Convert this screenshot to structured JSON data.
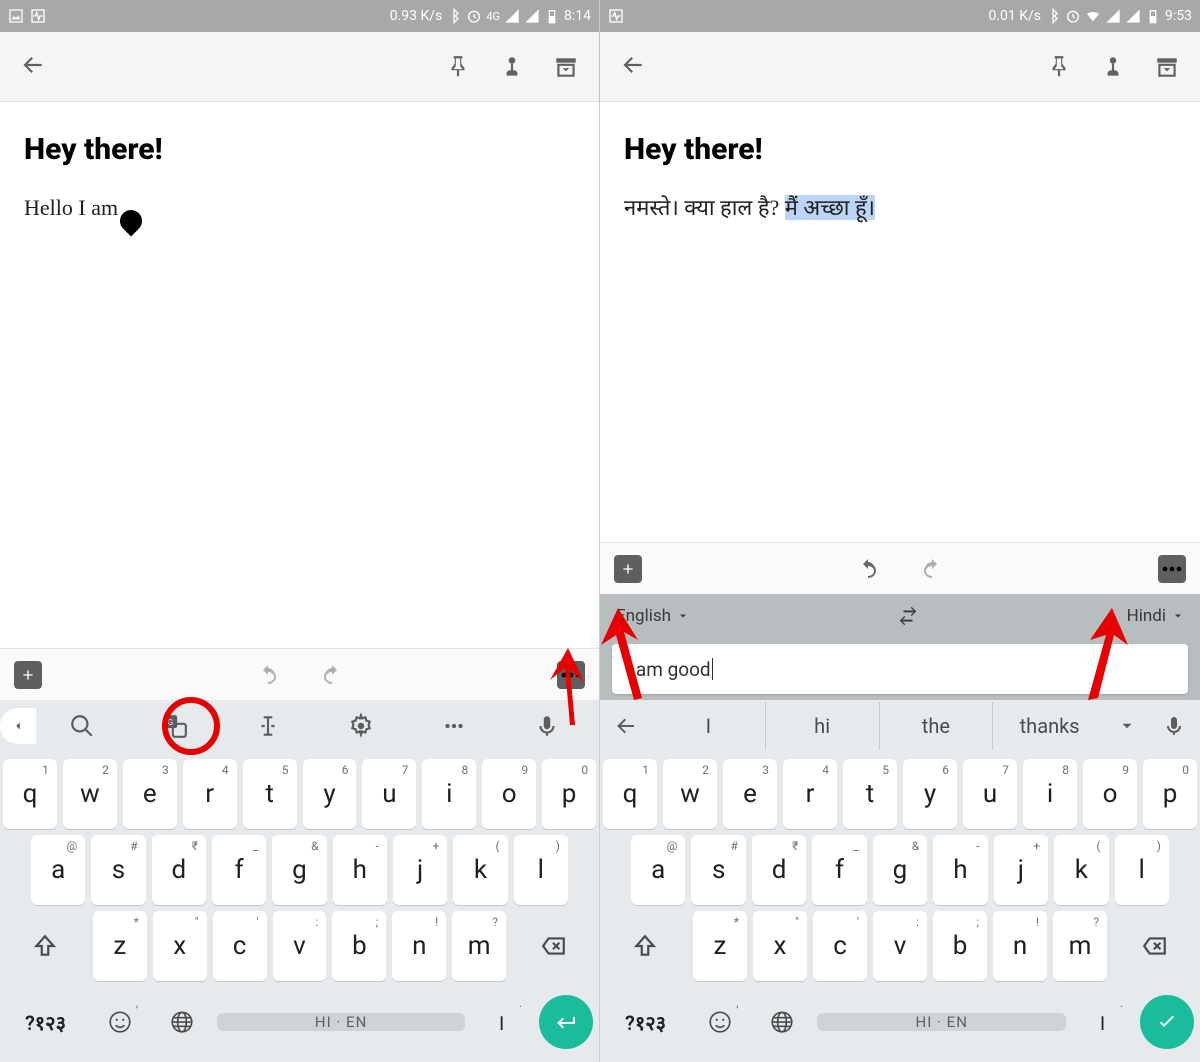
{
  "left": {
    "status": {
      "speed": "0.93 K/s",
      "net": "4G",
      "time": "8:14"
    },
    "heading": "Hey there!",
    "body": "Hello I am",
    "toolstrip": [
      "search",
      "translate",
      "cursor",
      "settings",
      "more",
      "mic"
    ],
    "keyboard": {
      "row1": [
        [
          "q",
          "1"
        ],
        [
          "w",
          "2"
        ],
        [
          "e",
          "3"
        ],
        [
          "r",
          "4"
        ],
        [
          "t",
          "5"
        ],
        [
          "y",
          "6"
        ],
        [
          "u",
          "7"
        ],
        [
          "i",
          "8"
        ],
        [
          "o",
          "9"
        ],
        [
          "p",
          "0"
        ]
      ],
      "row2": [
        [
          "a",
          "@"
        ],
        [
          "s",
          "#"
        ],
        [
          "d",
          "₹"
        ],
        [
          "f",
          "_"
        ],
        [
          "g",
          "&"
        ],
        [
          "h",
          "-"
        ],
        [
          "j",
          "+"
        ],
        [
          "k",
          "("
        ],
        [
          "l",
          ")"
        ]
      ],
      "row3": [
        [
          "z",
          "*"
        ],
        [
          "x",
          "\""
        ],
        [
          "c",
          "'"
        ],
        [
          "v",
          ":"
        ],
        [
          "b",
          ";"
        ],
        [
          "n",
          "!"
        ],
        [
          "m",
          "?"
        ]
      ],
      "sym": "?१२३",
      "space": "HI · EN"
    }
  },
  "right": {
    "status": {
      "speed": "0.01 K/s",
      "time": "9:53"
    },
    "heading": "Hey there!",
    "body_plain": "नमस्ते। क्या हाल है? ",
    "body_highlight": "मैं अच्छा हूँ।",
    "translate": {
      "from": "English",
      "to": "Hindi",
      "input": "I am good "
    },
    "suggestions": [
      "I",
      "hi",
      "the",
      "thanks"
    ],
    "keyboard": {
      "row1": [
        [
          "q",
          "1"
        ],
        [
          "w",
          "2"
        ],
        [
          "e",
          "3"
        ],
        [
          "r",
          "4"
        ],
        [
          "t",
          "5"
        ],
        [
          "y",
          "6"
        ],
        [
          "u",
          "7"
        ],
        [
          "i",
          "8"
        ],
        [
          "o",
          "9"
        ],
        [
          "p",
          "0"
        ]
      ],
      "row2": [
        [
          "a",
          "@"
        ],
        [
          "s",
          "#"
        ],
        [
          "d",
          "₹"
        ],
        [
          "f",
          "_"
        ],
        [
          "g",
          "&"
        ],
        [
          "h",
          "-"
        ],
        [
          "j",
          "+"
        ],
        [
          "k",
          "("
        ],
        [
          "l",
          ")"
        ]
      ],
      "row3": [
        [
          "z",
          "*"
        ],
        [
          "x",
          "\""
        ],
        [
          "c",
          "'"
        ],
        [
          "v",
          ":"
        ],
        [
          "b",
          ";"
        ],
        [
          "n",
          "!"
        ],
        [
          "m",
          "?"
        ]
      ],
      "sym": "?१२३",
      "space": "HI · EN"
    }
  }
}
